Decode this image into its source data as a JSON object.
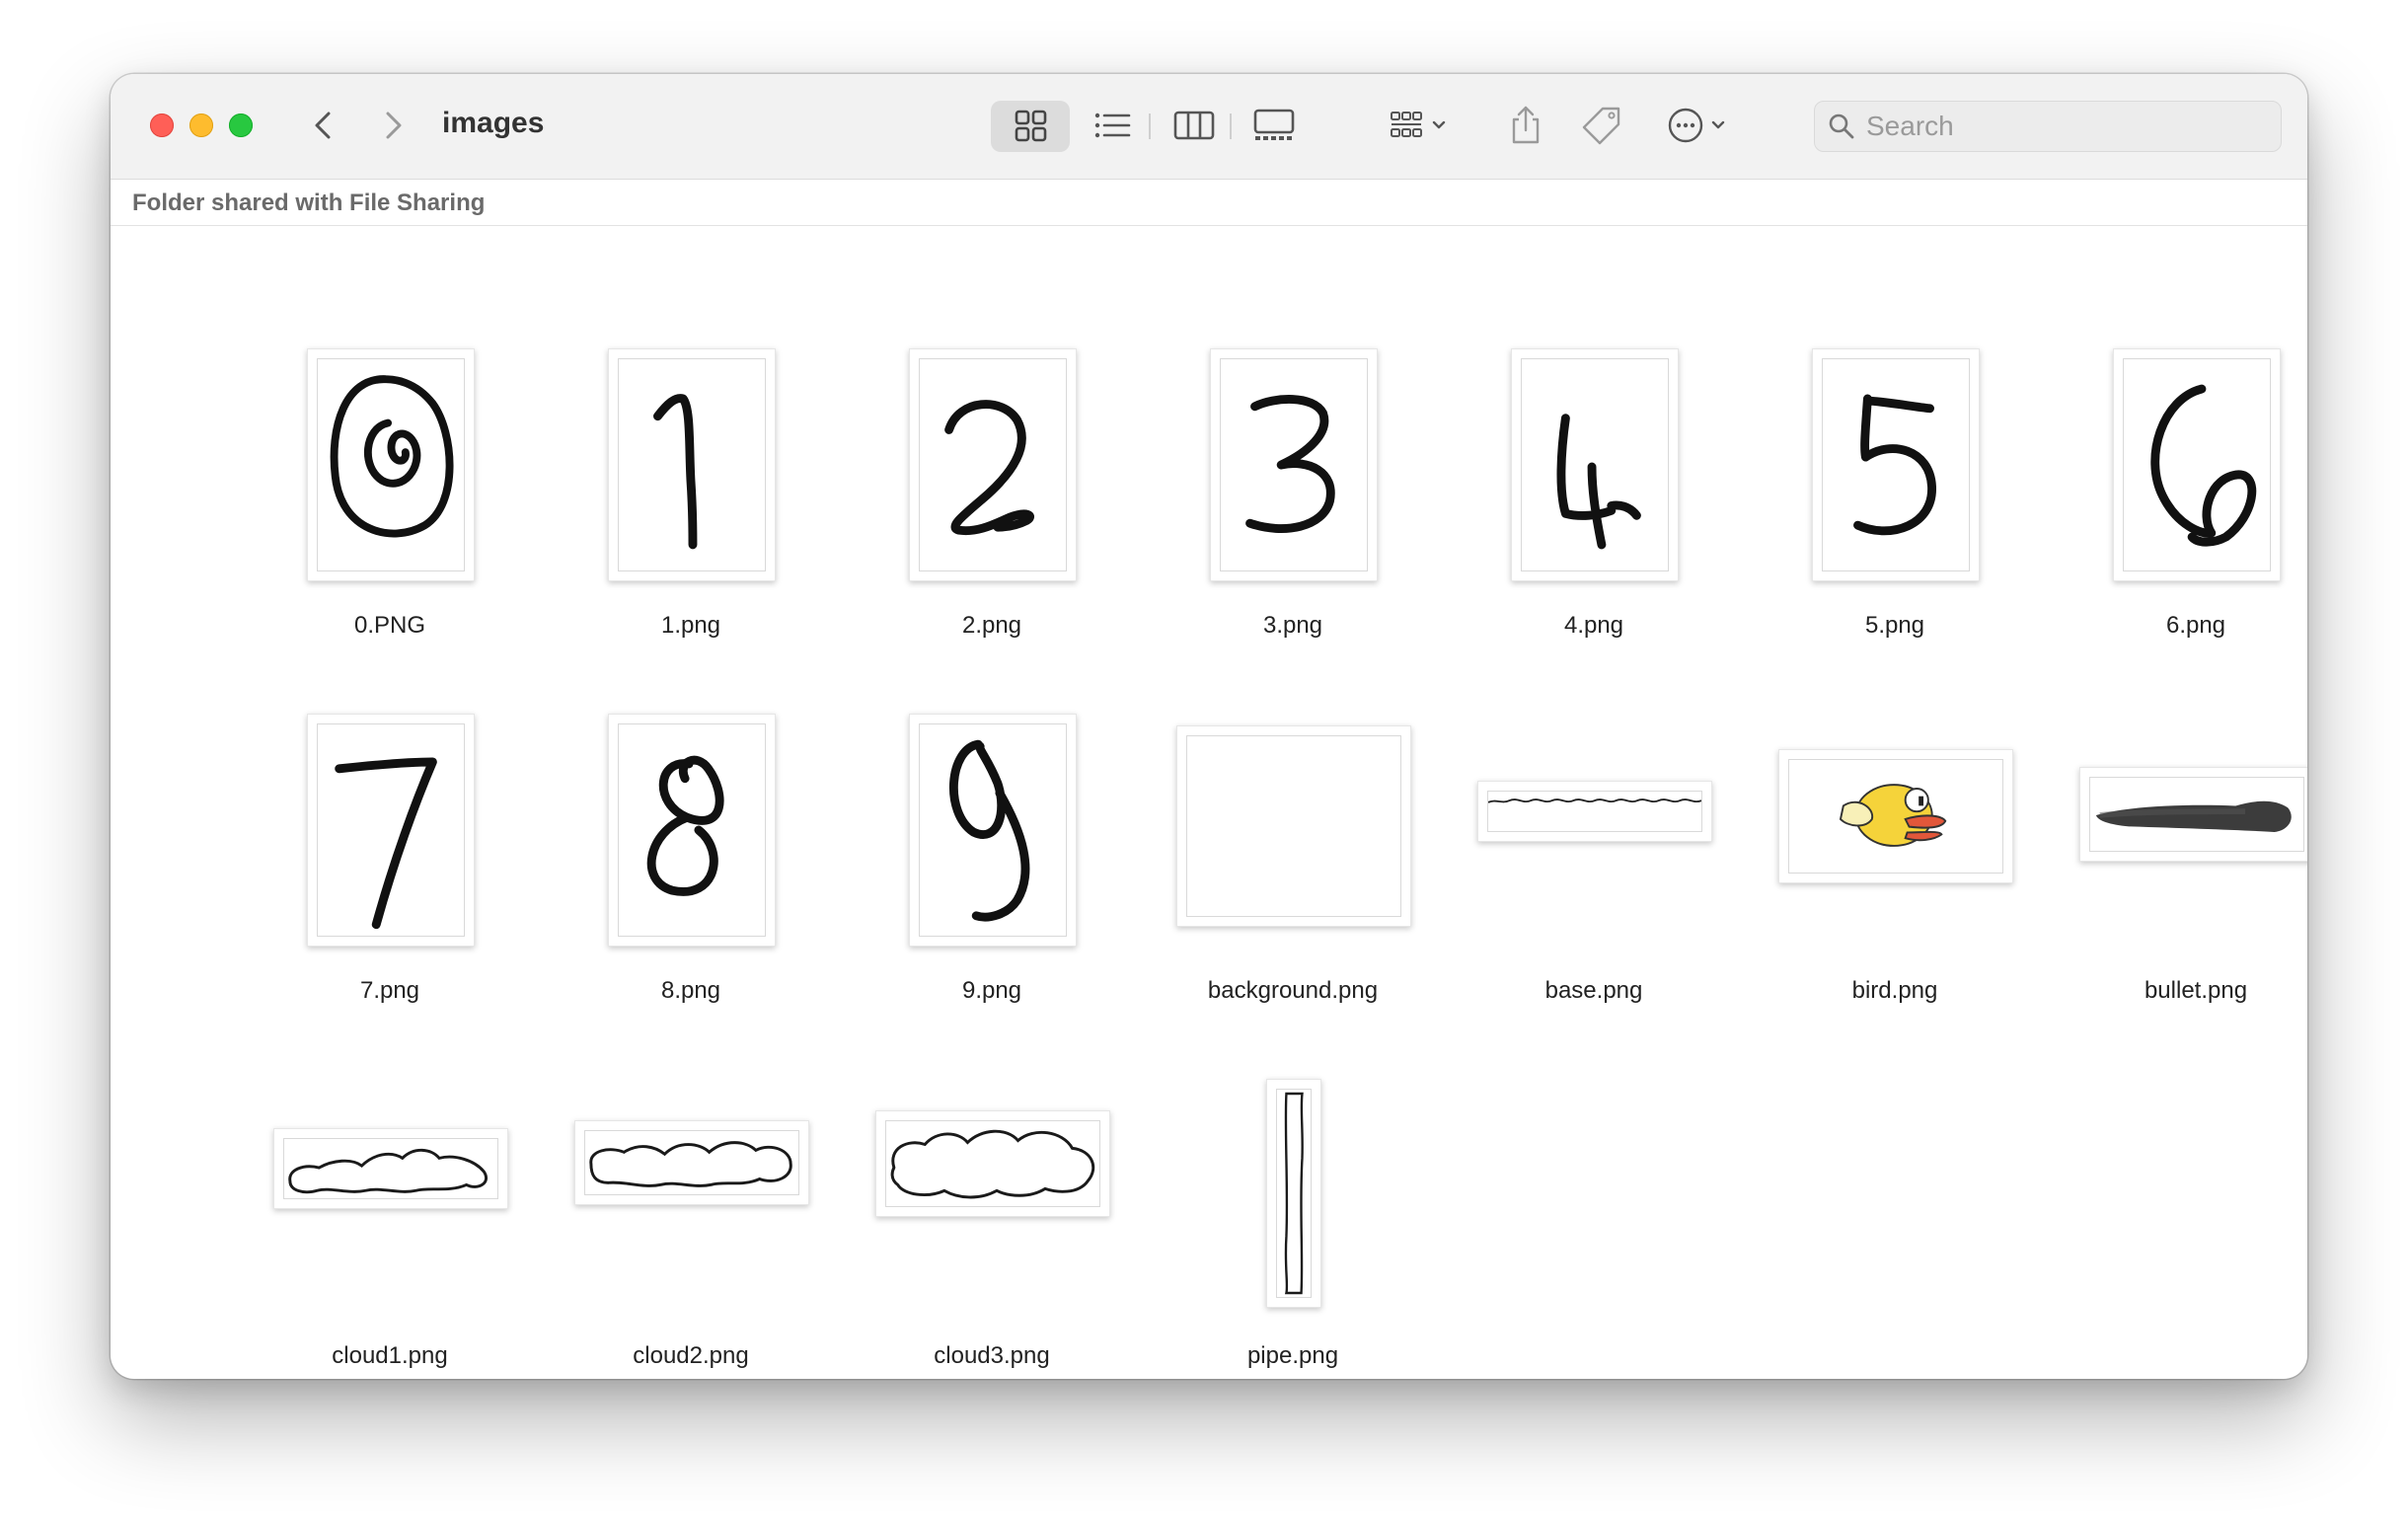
{
  "window": {
    "title": "images"
  },
  "toolbar": {
    "icons": [
      "icon-view-icon",
      "list-view-icon",
      "column-view-icon",
      "gallery-view-icon",
      "group-by-icon",
      "share-icon",
      "tag-icon",
      "more-actions-icon"
    ],
    "search_placeholder": "Search"
  },
  "path_bar": {
    "text": "Folder shared with File Sharing"
  },
  "files": [
    {
      "name": "0.PNG"
    },
    {
      "name": "1.png"
    },
    {
      "name": "2.png"
    },
    {
      "name": "3.png"
    },
    {
      "name": "4.png"
    },
    {
      "name": "5.png"
    },
    {
      "name": "6.png"
    },
    {
      "name": "7.png"
    },
    {
      "name": "8.png"
    },
    {
      "name": "9.png"
    },
    {
      "name": "background.png"
    },
    {
      "name": "base.png"
    },
    {
      "name": "bird.png"
    },
    {
      "name": "bullet.png"
    },
    {
      "name": "cloud1.png"
    },
    {
      "name": "cloud2.png"
    },
    {
      "name": "cloud3.png"
    },
    {
      "name": "pipe.png"
    }
  ],
  "colors": {
    "close": "#ff5f57",
    "minimize": "#febc2e",
    "zoom": "#28c840",
    "bird_body": "#f5d33a",
    "bird_beak": "#e2573a"
  }
}
